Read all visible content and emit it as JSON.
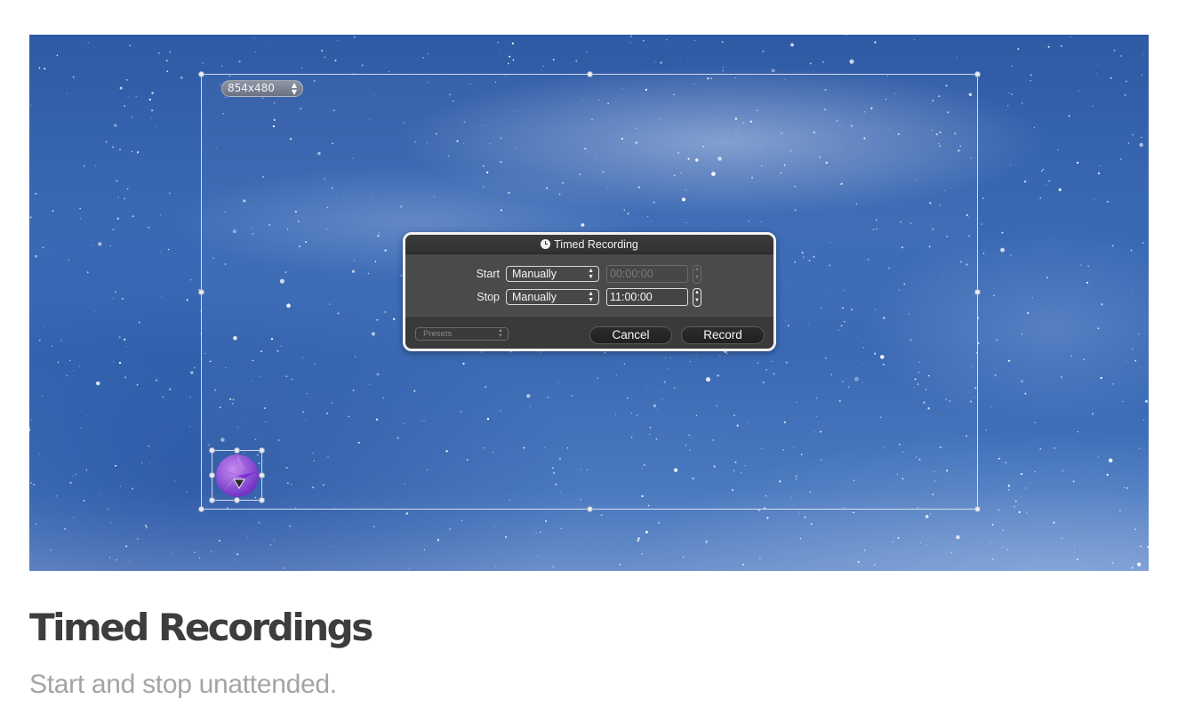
{
  "selection": {
    "size_label": "854x480",
    "size_arrows": "▲▼"
  },
  "dialog": {
    "title": "Timed Recording",
    "start": {
      "label": "Start",
      "mode": "Manually",
      "time": "00:00:00",
      "time_enabled": false
    },
    "stop": {
      "label": "Stop",
      "mode": "Manually",
      "time": "11:00:00",
      "time_enabled": true
    },
    "presets_placeholder": "Presets",
    "cancel_label": "Cancel",
    "record_label": "Record"
  },
  "caption": {
    "title": "Timed Recordings",
    "subtitle": "Start and stop unattended."
  },
  "colors": {
    "sky_base": "#3566b2",
    "dialog_bg": "#484848",
    "title_text": "#3d3d3d",
    "subtitle_text": "#a4a4a4",
    "logo_purple": "#8a3fd6"
  },
  "icons": {
    "dialog_title_icon": "clock-icon",
    "app_logo": "aperture-logo-icon"
  }
}
